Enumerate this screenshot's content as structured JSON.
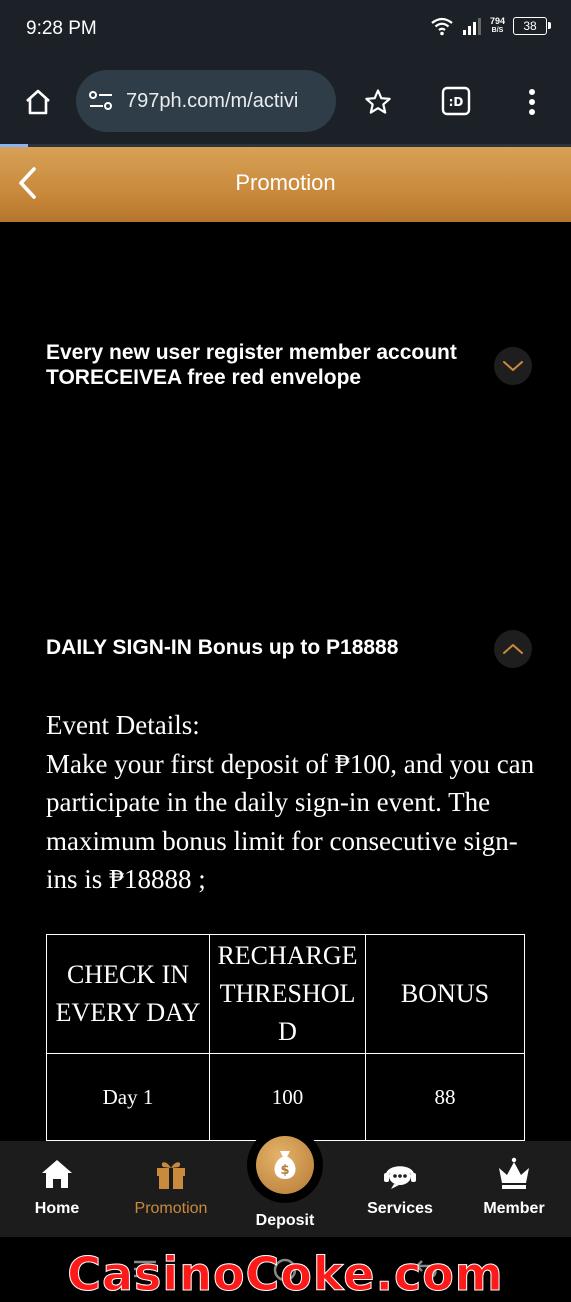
{
  "status_bar": {
    "time": "9:28 PM",
    "net_speed_value": "794",
    "net_speed_unit": "B/S",
    "battery": "38"
  },
  "browser": {
    "url": "797ph.com/m/activi",
    "icons": [
      "home-icon",
      "site-settings-icon",
      "star-icon",
      "tab-switcher-icon",
      "more-vert-icon"
    ]
  },
  "header": {
    "title": "Promotion"
  },
  "promotions": [
    {
      "title_line1": "Every new user register member account",
      "title_line2": "TORECEIVEA free red envelope",
      "expanded": false
    },
    {
      "title": "DAILY SIGN-IN Bonus up to P18888",
      "expanded": true,
      "details_heading": "Event Details:",
      "details_body": "Make your first deposit of ₱100, and you can participate in the daily sign-in event. The maximum bonus limit for consecutive sign-ins is ₱18888 ;",
      "table": {
        "headers": [
          "CHECK IN EVERY DAY",
          "RECHARGE THRESHOLD",
          "BONUS"
        ],
        "rows": [
          [
            "Day 1",
            "100",
            "88"
          ]
        ]
      }
    }
  ],
  "bottom_nav": {
    "items": [
      {
        "label": "Home",
        "icon": "home-icon"
      },
      {
        "label": "Promotion",
        "icon": "gift-icon",
        "active": true
      },
      {
        "label": "Deposit",
        "icon": "money-bag-icon"
      },
      {
        "label": "Services",
        "icon": "headset-icon"
      },
      {
        "label": "Member",
        "icon": "crown-icon"
      }
    ]
  },
  "watermark": "CasinoCoke.com",
  "colors": {
    "accent": "#c98a3c",
    "background": "#000000",
    "watermark": "#ff1a1a"
  }
}
